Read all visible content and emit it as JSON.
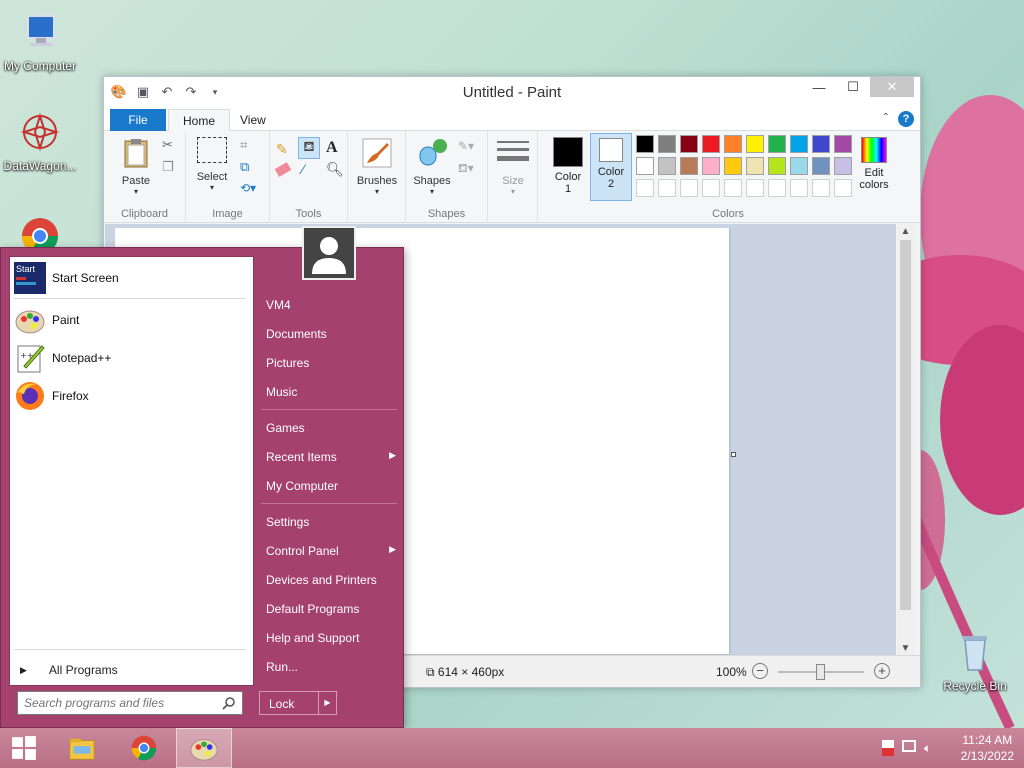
{
  "desktop": {
    "icons": [
      {
        "label": "My Computer"
      },
      {
        "label": "DataWagon..."
      },
      {
        "label": "Recycle Bin"
      }
    ]
  },
  "paint": {
    "title": "Untitled - Paint",
    "tabs": {
      "file": "File",
      "home": "Home",
      "view": "View"
    },
    "groups": {
      "clipboard": {
        "label": "Clipboard",
        "paste": "Paste"
      },
      "image": {
        "label": "Image",
        "select": "Select"
      },
      "tools": {
        "label": "Tools"
      },
      "brushes": "Brushes",
      "shapes": {
        "label": "Shapes",
        "button": "Shapes"
      },
      "size": "Size",
      "colors": {
        "label": "Colors",
        "color1": "Color 1",
        "color2": "Color 2",
        "edit": "Edit colors"
      }
    },
    "palette_row1": [
      "#000000",
      "#7f7f7f",
      "#880015",
      "#ed1c24",
      "#ff7f27",
      "#fff200",
      "#22b14c",
      "#00a2e8",
      "#3f48cc",
      "#a349a4"
    ],
    "palette_row2": [
      "#ffffff",
      "#c3c3c3",
      "#b97a57",
      "#ffaec9",
      "#ffc90e",
      "#efe4b0",
      "#b5e61d",
      "#99d9ea",
      "#7092be",
      "#c8bfe7"
    ],
    "status": {
      "dimensions": "614 × 460px",
      "zoom": "100%"
    }
  },
  "start_menu": {
    "left_items": [
      {
        "label": "Start Screen"
      },
      {
        "label": "Paint"
      },
      {
        "label": "Notepad++"
      },
      {
        "label": "Firefox"
      }
    ],
    "all_programs": "All Programs",
    "search_placeholder": "Search programs and files",
    "right_items": [
      {
        "label": "VM4"
      },
      {
        "label": "Documents"
      },
      {
        "label": "Pictures"
      },
      {
        "label": "Music"
      },
      {
        "label": "Games"
      },
      {
        "label": "Recent Items"
      },
      {
        "label": "My Computer"
      },
      {
        "label": "Settings"
      },
      {
        "label": "Control Panel"
      },
      {
        "label": "Devices and Printers"
      },
      {
        "label": "Default Programs"
      },
      {
        "label": "Help and Support"
      },
      {
        "label": "Run..."
      }
    ],
    "lock": "Lock",
    "start_icon_text": "Start"
  },
  "taskbar": {
    "time": "11:24 AM",
    "date": "2/13/2022"
  }
}
